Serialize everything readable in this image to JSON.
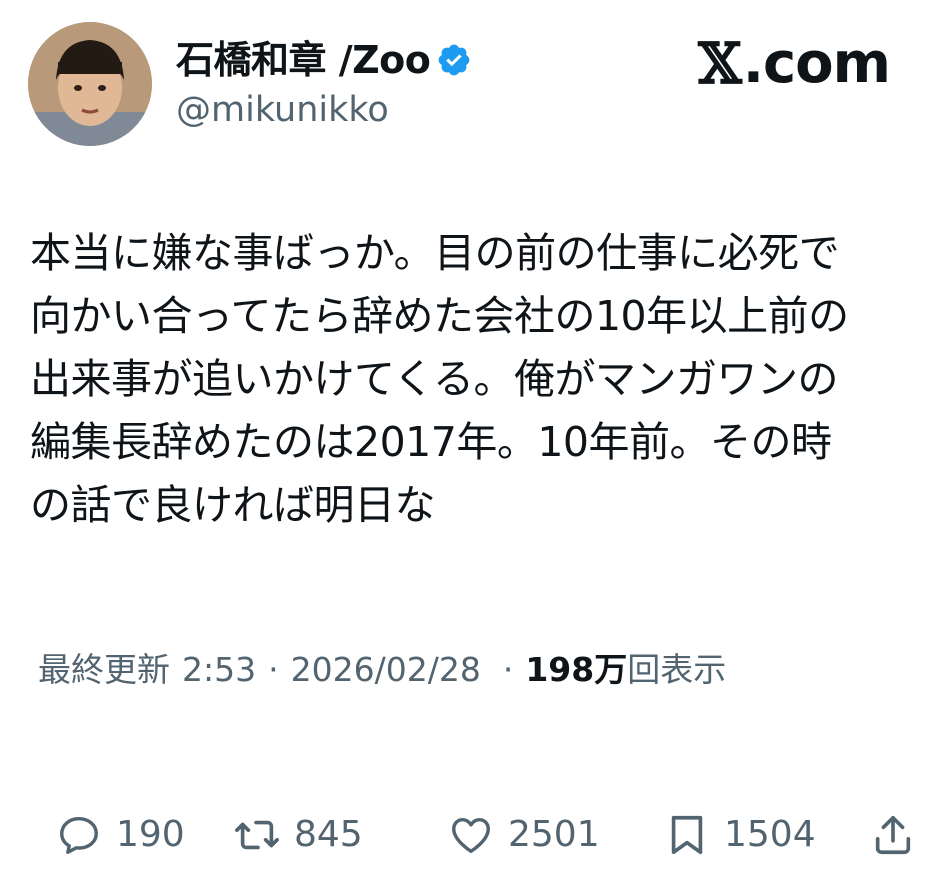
{
  "author": {
    "display_name": "石橋和章 /Zoo",
    "handle": "@mikunikko",
    "verified": true,
    "verified_color": "#1d9bf0"
  },
  "brand": {
    "glyph": "𝕏",
    "suffix": ".com"
  },
  "tweet": {
    "lines": [
      "本当に嫌な事ばっか。目の前の仕事に必死で",
      "向かい合ってたら辞めた会社の10年以上前の",
      "出来事が追いかけてくる。俺がマンガワンの",
      "編集長辞めたのは2017年。10年前。その時",
      "の話で良ければ明日な"
    ]
  },
  "meta": {
    "updated_label": "最終更新",
    "time": "2:53",
    "date": "2026/02/28",
    "separator": "·",
    "views_count": "198万",
    "views_label": "回表示"
  },
  "actions": {
    "replies": {
      "icon": "reply-icon",
      "count": "190"
    },
    "reposts": {
      "icon": "repost-icon",
      "count": "845"
    },
    "likes": {
      "icon": "heart-icon",
      "count": "2501"
    },
    "bookmarks": {
      "icon": "bookmark-icon",
      "count": "1504"
    },
    "share": {
      "icon": "share-icon"
    }
  },
  "colors": {
    "text": "#0f1419",
    "secondary": "#536471"
  }
}
